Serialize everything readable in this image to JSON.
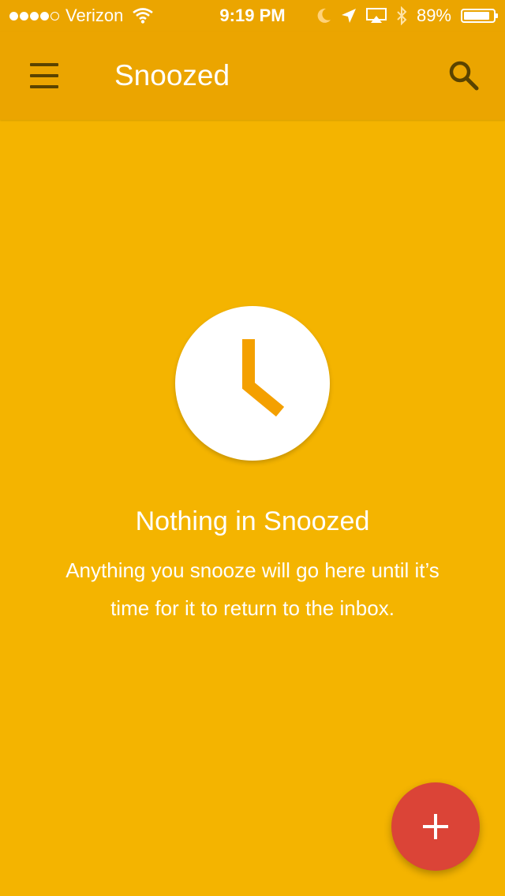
{
  "status_bar": {
    "carrier": "Verizon",
    "time": "9:19 PM",
    "battery_percent": "89%",
    "battery_level": 0.89,
    "signal_bars_filled": 4,
    "signal_bars_total": 5
  },
  "app_bar": {
    "title": "Snoozed",
    "menu_icon": "hamburger-menu-icon",
    "search_icon": "search-icon"
  },
  "empty_state": {
    "icon": "clock-icon",
    "title": "Nothing in Snoozed",
    "description": "Anything you snooze will go here until it’s time for it to return to the inbox."
  },
  "fab": {
    "icon": "plus-icon"
  },
  "colors": {
    "background": "#F4B400",
    "app_bar": "#EBA500",
    "clock_hands": "#F4A000",
    "fab": "#DB4437"
  }
}
